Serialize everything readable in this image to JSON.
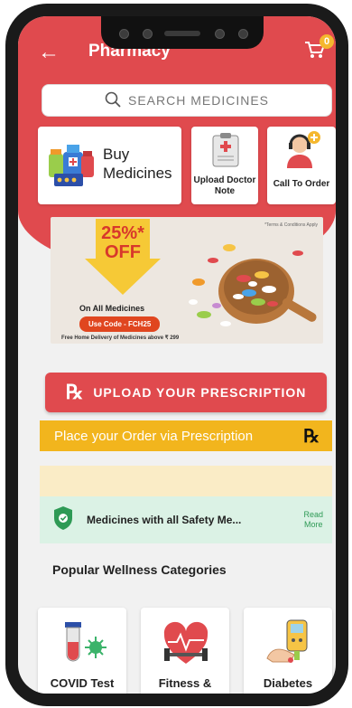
{
  "header": {
    "title": "Pharmacy",
    "cart_count": "0"
  },
  "search": {
    "placeholder": "SEARCH MEDICINES"
  },
  "cards": {
    "buy_label": "Buy\nMedicines",
    "upload_label": "Upload Doctor Note",
    "call_label": "Call To Order"
  },
  "banner": {
    "terms": "*Terms & Conditions Apply",
    "discount_line1": "25%*",
    "discount_line2": "OFF",
    "on_all": "On All Medicines",
    "code": "Use Code - FCH25",
    "free_delivery": "Free Home Delivery of Medicines above ₹ 299"
  },
  "upload_prescription": {
    "label": "UPLOAD YOUR PRESCRIPTION"
  },
  "place_order": {
    "label": "Place your Order via Prescription",
    "rx": "℞"
  },
  "safety": {
    "text": "Medicines with all Safety Me...",
    "read_more": "Read\nMore"
  },
  "wellness": {
    "title": "Popular Wellness Categories",
    "items": [
      "COVID Test",
      "Fitness &",
      "Diabetes"
    ]
  },
  "colors": {
    "brand": "#e04a4e",
    "accent": "#f2b51d",
    "safety_bg": "#dbf2e5"
  }
}
